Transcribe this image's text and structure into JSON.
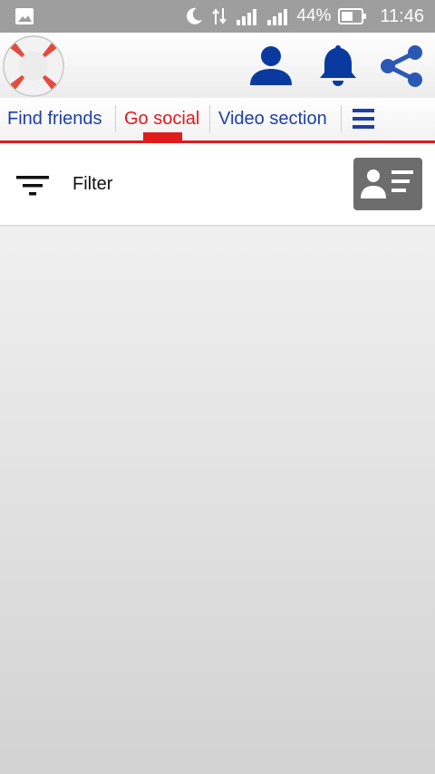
{
  "status_bar": {
    "battery_percent": "44%",
    "time": "11:46",
    "icons": [
      "gallery-icon",
      "moon-icon",
      "data-arrows-icon",
      "signal-icon",
      "battery-icon"
    ]
  },
  "header": {
    "icons": [
      "lifebuoy-logo-icon",
      "user-icon",
      "bell-icon",
      "share-icon"
    ],
    "colors": {
      "icon_blue": "#0a3aa0",
      "logo_red": "#e64a3c"
    }
  },
  "tabs": {
    "items": [
      {
        "label": "Find friends",
        "active": false
      },
      {
        "label": "Go social",
        "active": true
      },
      {
        "label": "Video section",
        "active": false
      }
    ],
    "colors": {
      "active": "#e01b1b",
      "inactive": "#1e3fa6"
    }
  },
  "filter": {
    "label": "Filter",
    "icons": [
      "filter-icon",
      "contact-card-icon"
    ]
  }
}
